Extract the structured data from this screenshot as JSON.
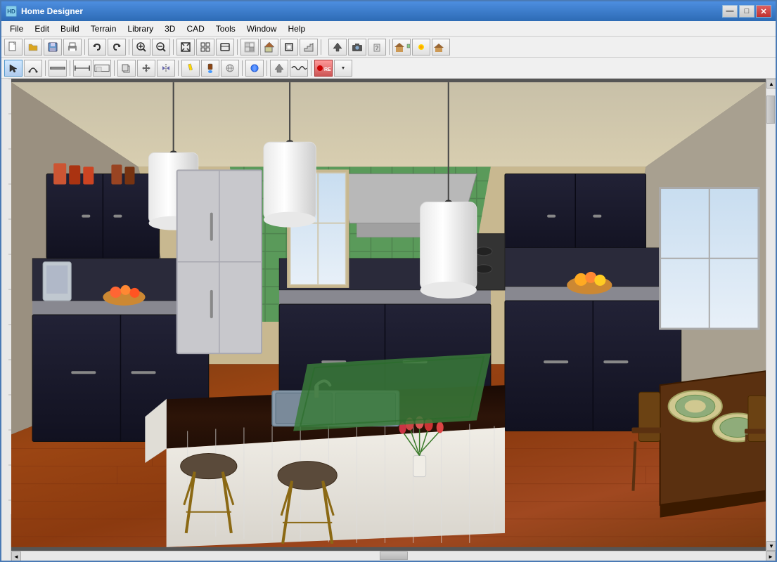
{
  "window": {
    "title": "Home Designer",
    "icon": "HD"
  },
  "title_bar": {
    "title": "Home Designer",
    "controls": {
      "minimize": "—",
      "maximize": "□",
      "close": "✕"
    }
  },
  "menu_bar": {
    "items": [
      "File",
      "Edit",
      "Build",
      "Terrain",
      "Library",
      "3D",
      "CAD",
      "Tools",
      "Window",
      "Help"
    ]
  },
  "toolbar1": {
    "buttons": [
      {
        "name": "new",
        "icon": "📄"
      },
      {
        "name": "open",
        "icon": "📁"
      },
      {
        "name": "save",
        "icon": "💾"
      },
      {
        "name": "print",
        "icon": "🖨"
      },
      {
        "name": "sep1",
        "icon": "|"
      },
      {
        "name": "undo",
        "icon": "↩"
      },
      {
        "name": "redo",
        "icon": "↪"
      },
      {
        "name": "zoom-in",
        "icon": "🔍"
      },
      {
        "name": "zoom-out",
        "icon": "🔍"
      },
      {
        "name": "sep2",
        "icon": "|"
      },
      {
        "name": "zoom-fit",
        "icon": "⊡"
      },
      {
        "name": "fill",
        "icon": "⊞"
      },
      {
        "name": "sep3",
        "icon": "|"
      },
      {
        "name": "draw-wall",
        "icon": "▦"
      },
      {
        "name": "sep4",
        "icon": "|"
      },
      {
        "name": "help",
        "icon": "?"
      },
      {
        "name": "sep5",
        "icon": "|"
      },
      {
        "name": "camera",
        "icon": "📷"
      },
      {
        "name": "walk",
        "icon": "🚶"
      },
      {
        "name": "house",
        "icon": "🏠"
      },
      {
        "name": "roof",
        "icon": "🏠"
      }
    ]
  },
  "toolbar2": {
    "buttons": [
      {
        "name": "select",
        "icon": "↖"
      },
      {
        "name": "polyline",
        "icon": "⌒"
      },
      {
        "name": "sep1",
        "icon": "|"
      },
      {
        "name": "wall",
        "icon": "▬"
      },
      {
        "name": "sep2",
        "icon": "|"
      },
      {
        "name": "dimension",
        "icon": "↔"
      },
      {
        "name": "floor-plan",
        "icon": "⊟"
      },
      {
        "name": "sep3",
        "icon": "|"
      },
      {
        "name": "copy",
        "icon": "⊞"
      },
      {
        "name": "move",
        "icon": "⊕"
      },
      {
        "name": "mirror",
        "icon": "⊣"
      },
      {
        "name": "sep4",
        "icon": "|"
      },
      {
        "name": "pencil",
        "icon": "✏"
      },
      {
        "name": "paint",
        "icon": "🎨"
      },
      {
        "name": "bucket",
        "icon": "🪣"
      },
      {
        "name": "sep5",
        "icon": "|"
      },
      {
        "name": "material",
        "icon": "🔷"
      },
      {
        "name": "sep6",
        "icon": "|"
      },
      {
        "name": "stairs",
        "icon": "⊿"
      },
      {
        "name": "terrain",
        "icon": "≋"
      },
      {
        "name": "sep7",
        "icon": "|"
      },
      {
        "name": "record",
        "icon": "●"
      }
    ]
  },
  "scene": {
    "description": "3D Kitchen view with dark cabinets, green tile backsplash, hardwood floor, island with sink"
  },
  "colors": {
    "floor": "#8B4513",
    "cabinet": "#1a1a2e",
    "tile_wall": "#5a9a5a",
    "island_top": "#2d1a0a",
    "island_base": "#f5f0e8",
    "pendant": "#ffffff",
    "back_wall": "#c8b88a"
  }
}
